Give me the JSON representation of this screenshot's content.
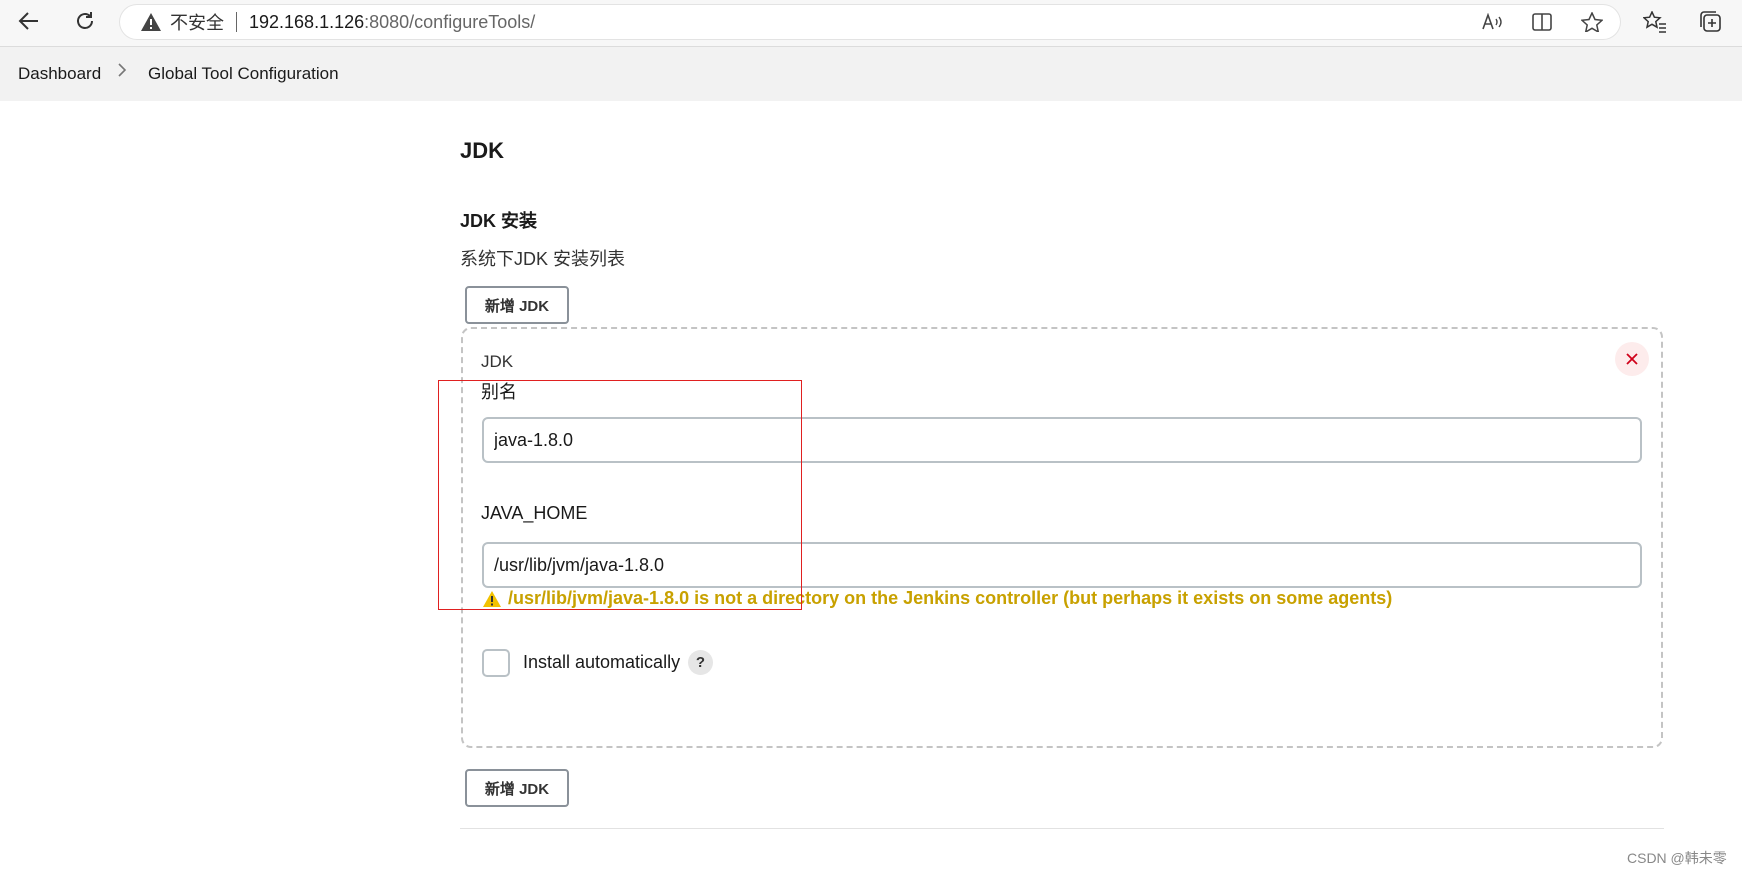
{
  "browser": {
    "insecure_label": "不安全",
    "url_host": "192.168.1.126",
    "url_rest": ":8080/configureTools/",
    "icons": [
      "back-arrow-icon",
      "refresh-icon",
      "warning-triangle-icon",
      "read-aloud-icon",
      "split-screen-icon",
      "favorite-star-icon",
      "favorites-list-icon",
      "collections-icon"
    ]
  },
  "breadcrumb": {
    "items": [
      {
        "label": "Dashboard"
      },
      {
        "label": "Global Tool Configuration"
      }
    ],
    "separator_icon": "chevron-right-icon"
  },
  "main": {
    "section_title": "JDK",
    "group_label": "JDK 安装",
    "group_description": "系统下JDK 安装列表",
    "add_button_label": "新增 JDK",
    "jdk_card": {
      "title": "JDK",
      "delete_icon": "close-icon",
      "alias_label": "别名",
      "alias_value": "java-1.8.0",
      "java_home_label": "JAVA_HOME",
      "java_home_value": "/usr/lib/jvm/java-1.8.0",
      "warning_message": "/usr/lib/jvm/java-1.8.0 is not a directory on the Jenkins controller (but perhaps it exists on some agents)",
      "install_auto_label": "Install automatically",
      "install_auto_checked": false,
      "help_label": "?"
    },
    "add_button_bottom_label": "新增 JDK"
  },
  "colors": {
    "warning": "#c8a100",
    "annotation_box": "#e02020",
    "delete": "#d0021b"
  },
  "watermark": "CSDN @韩未零"
}
